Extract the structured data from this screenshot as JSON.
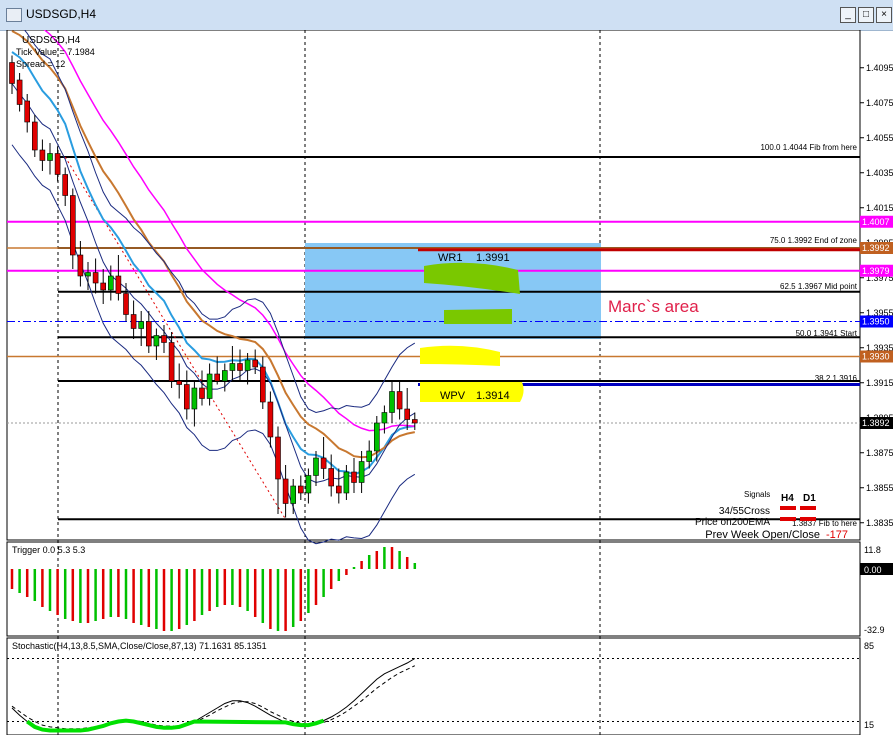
{
  "window": {
    "title": "USDSGD,H4",
    "icon": "chart-window-icon",
    "buttons": [
      "minimize-icon",
      "maximize-icon",
      "close-icon"
    ]
  },
  "main": {
    "symbol_tf": "USDSGD,H4",
    "info_lines": [
      "Tick Value = 7.1984",
      "Spread = 12"
    ],
    "marcs_area": "Marc`s area",
    "wr1_label": "WR1",
    "wr1_value": "1.3991",
    "wpv_label": "WPV",
    "wpv_value": "1.3914",
    "signals_title": "Signals",
    "signals_h4": "H4",
    "signals_d1": "D1",
    "signals_rows": [
      "34/55Cross",
      "Price on200EMA"
    ],
    "prev_week_label": "Prev Week Open/Close",
    "prev_week_value": "-177",
    "fib_labels": [
      {
        "text": "100.0  1.4044    Fib from here"
      },
      {
        "text": "75.0    1.3992    End of zone"
      },
      {
        "text": "62.5    1.3967    Mid point"
      },
      {
        "text": "50.0    1.3941    Start"
      },
      {
        "text": "38.2  1.3916"
      },
      {
        "text": "1.3837   Fib to here"
      }
    ]
  },
  "price_axis": {
    "ticks": [
      "1.4095",
      "1.4075",
      "1.4055",
      "1.4035",
      "1.4015",
      "1.3995",
      "1.3975",
      "1.3955",
      "1.3935",
      "1.3915",
      "1.3895",
      "1.3875",
      "1.3855",
      "1.3835"
    ],
    "flags": [
      {
        "text": "1.4007",
        "color": "#ff00ff"
      },
      {
        "text": "1.3992",
        "color": "#c06020"
      },
      {
        "text": "1.3979",
        "color": "#ff00ff"
      },
      {
        "text": "1.3950",
        "color": "#0000ff"
      },
      {
        "text": "1.3930",
        "color": "#c06020"
      },
      {
        "text": "1.3892",
        "color": "#000000"
      }
    ]
  },
  "trigger": {
    "title": "Trigger 0.0 5.3 5.3",
    "ticks": [
      "11.8",
      "0.00",
      "-32.9"
    ]
  },
  "stochastic": {
    "title": "Stochastic(H4,13,8.5,SMA,Close/Close,87,13) 71.1631 85.1351",
    "ticks": [
      "85",
      "15"
    ]
  },
  "colors": {
    "bull": "#00c000",
    "bear": "#e00000",
    "zone": "#87c8f5",
    "magenta": "#ff00ff",
    "orange": "#c87830",
    "blue": "#2a9de0",
    "navy": "#1a2a80",
    "highlight": "#ffff00",
    "green_marker": "#7ac800"
  },
  "chart_data": {
    "type": "candlestick",
    "price_ylim": [
      1.3828,
      1.4112
    ],
    "candles": [
      [
        1.4098,
        1.4102,
        1.408,
        1.4086
      ],
      [
        1.4088,
        1.4092,
        1.407,
        1.4074
      ],
      [
        1.4076,
        1.408,
        1.4058,
        1.4064
      ],
      [
        1.4064,
        1.4068,
        1.4044,
        1.4048
      ],
      [
        1.4048,
        1.4054,
        1.4036,
        1.4042
      ],
      [
        1.4042,
        1.4052,
        1.4034,
        1.4046
      ],
      [
        1.4046,
        1.405,
        1.403,
        1.4034
      ],
      [
        1.4034,
        1.4038,
        1.4016,
        1.4022
      ],
      [
        1.4022,
        1.4026,
        1.398,
        1.3988
      ],
      [
        1.3988,
        1.3996,
        1.397,
        1.3976
      ],
      [
        1.3976,
        1.3984,
        1.3968,
        1.3978
      ],
      [
        1.3978,
        1.3986,
        1.3966,
        1.3972
      ],
      [
        1.3972,
        1.398,
        1.396,
        1.3968
      ],
      [
        1.3968,
        1.3982,
        1.3962,
        1.3976
      ],
      [
        1.3976,
        1.3988,
        1.3962,
        1.3966
      ],
      [
        1.3966,
        1.3972,
        1.395,
        1.3954
      ],
      [
        1.3954,
        1.3962,
        1.394,
        1.3946
      ],
      [
        1.3946,
        1.3956,
        1.3936,
        1.395
      ],
      [
        1.395,
        1.3956,
        1.3932,
        1.3936
      ],
      [
        1.3936,
        1.3946,
        1.3928,
        1.3942
      ],
      [
        1.3942,
        1.3948,
        1.3932,
        1.3938
      ],
      [
        1.3938,
        1.3944,
        1.3912,
        1.3916
      ],
      [
        1.3916,
        1.3926,
        1.3906,
        1.3914
      ],
      [
        1.3914,
        1.3922,
        1.3894,
        1.39
      ],
      [
        1.39,
        1.3916,
        1.389,
        1.3912
      ],
      [
        1.3912,
        1.3922,
        1.3902,
        1.3906
      ],
      [
        1.3906,
        1.3926,
        1.3902,
        1.392
      ],
      [
        1.392,
        1.393,
        1.3914,
        1.3916
      ],
      [
        1.3916,
        1.3926,
        1.391,
        1.3922
      ],
      [
        1.3922,
        1.3936,
        1.3916,
        1.3926
      ],
      [
        1.3926,
        1.3934,
        1.3916,
        1.3922
      ],
      [
        1.3922,
        1.3932,
        1.3914,
        1.3928
      ],
      [
        1.3928,
        1.3934,
        1.392,
        1.3924
      ],
      [
        1.3924,
        1.393,
        1.39,
        1.3904
      ],
      [
        1.3904,
        1.391,
        1.3878,
        1.3884
      ],
      [
        1.3884,
        1.389,
        1.384,
        1.386
      ],
      [
        1.386,
        1.3868,
        1.3838,
        1.3846
      ],
      [
        1.3846,
        1.386,
        1.384,
        1.3856
      ],
      [
        1.3856,
        1.3862,
        1.3848,
        1.3852
      ],
      [
        1.3852,
        1.3866,
        1.3846,
        1.3862
      ],
      [
        1.3862,
        1.3876,
        1.3856,
        1.3872
      ],
      [
        1.3872,
        1.3884,
        1.386,
        1.3866
      ],
      [
        1.3866,
        1.3874,
        1.385,
        1.3856
      ],
      [
        1.3856,
        1.3866,
        1.3846,
        1.3852
      ],
      [
        1.3852,
        1.3868,
        1.3848,
        1.3864
      ],
      [
        1.3864,
        1.3872,
        1.3852,
        1.3858
      ],
      [
        1.3858,
        1.3876,
        1.3852,
        1.387
      ],
      [
        1.387,
        1.3882,
        1.3866,
        1.3876
      ],
      [
        1.3876,
        1.3896,
        1.387,
        1.3892
      ],
      [
        1.3892,
        1.3902,
        1.3886,
        1.3898
      ],
      [
        1.3898,
        1.3916,
        1.3892,
        1.391
      ],
      [
        1.391,
        1.3916,
        1.3894,
        1.39
      ],
      [
        1.39,
        1.3912,
        1.3888,
        1.3894
      ],
      [
        1.3894,
        1.3898,
        1.3888,
        1.3892
      ]
    ],
    "levels": [
      1.4044,
      1.3992,
      1.3967,
      1.3941,
      1.3916,
      1.3837
    ],
    "trigger_values": [
      -10,
      -12,
      -14,
      -16,
      -19,
      -21,
      -23,
      -25,
      -26,
      -27,
      -27,
      -26,
      -25,
      -24,
      -24,
      -25,
      -27,
      -28,
      -29,
      -30,
      -31,
      -31,
      -30,
      -28,
      -26,
      -23,
      -21,
      -19,
      -18,
      -18,
      -19,
      -21,
      -24,
      -27,
      -30,
      -31,
      -31,
      -29,
      -26,
      -22,
      -18,
      -14,
      -10,
      -6,
      -3,
      1,
      4,
      7,
      9,
      11,
      11,
      9,
      6,
      3
    ],
    "stoch_main": [
      30,
      22,
      15,
      9,
      6,
      5,
      5,
      5,
      5,
      5,
      6,
      8,
      10,
      13,
      15,
      16,
      15,
      13,
      11,
      9,
      8,
      8,
      9,
      12,
      15,
      20,
      25,
      30,
      35,
      38,
      38,
      36,
      32,
      27,
      22,
      18,
      14,
      12,
      11,
      11,
      13,
      16,
      20,
      25,
      31,
      38,
      46,
      54,
      62,
      68,
      72,
      76,
      80,
      85
    ],
    "stoch_signal": [
      32,
      26,
      20,
      15,
      11,
      9,
      8,
      7,
      7,
      7,
      8,
      9,
      11,
      13,
      15,
      16,
      16,
      15,
      13,
      11,
      10,
      10,
      10,
      11,
      14,
      18,
      22,
      27,
      31,
      35,
      37,
      37,
      35,
      31,
      26,
      22,
      18,
      15,
      13,
      12,
      12,
      14,
      17,
      21,
      26,
      32,
      38,
      45,
      52,
      58,
      64,
      69,
      73,
      77
    ]
  }
}
